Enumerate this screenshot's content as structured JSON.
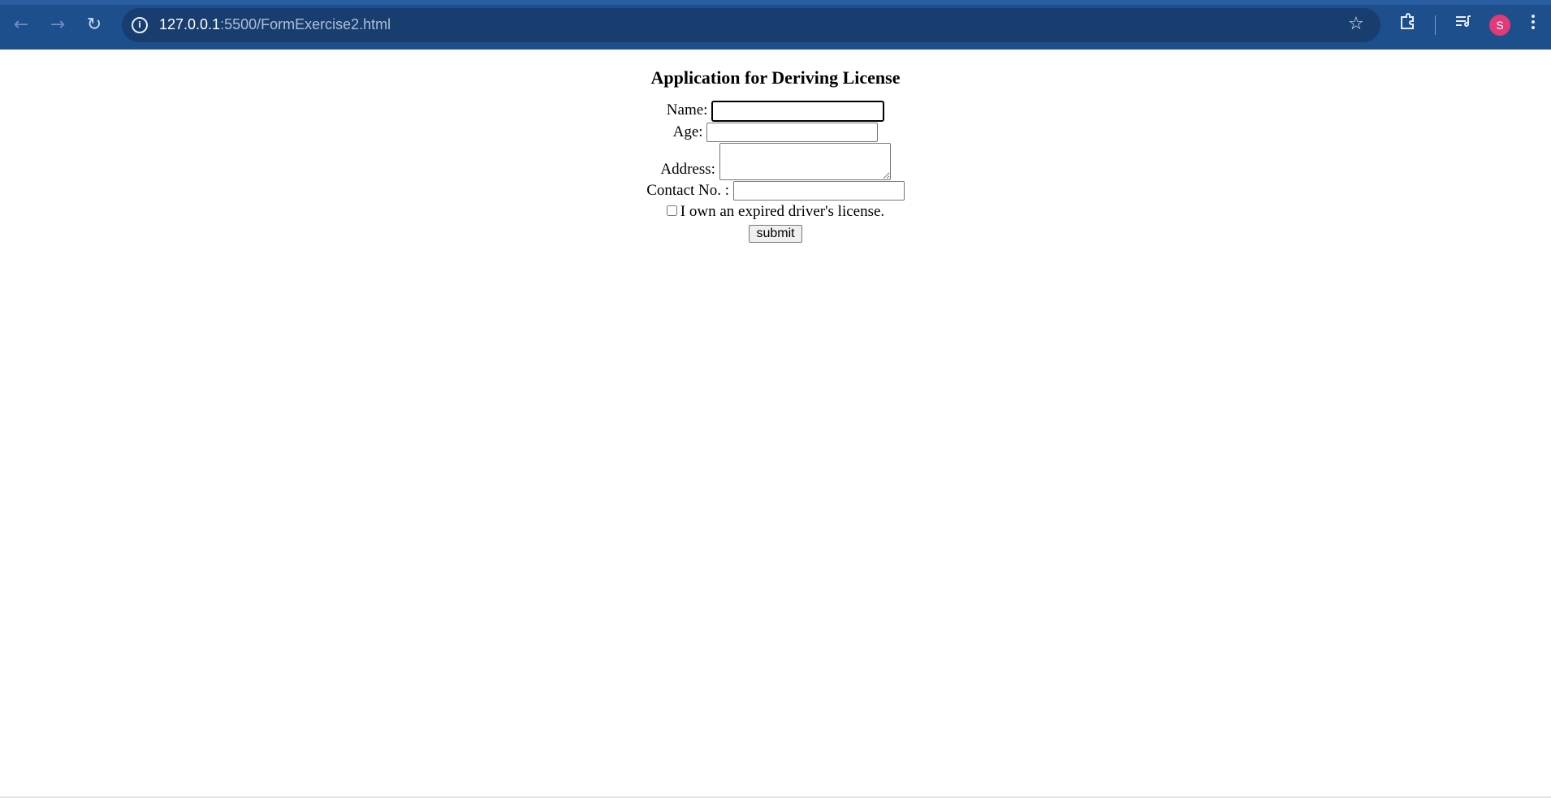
{
  "browser": {
    "back_icon": "←",
    "forward_icon": "→",
    "reload_icon": "↻",
    "url_host": "127.0.0.1",
    "url_rest": ":5500/FormExercise2.html",
    "info_icon": "i",
    "star_icon": "☆",
    "avatar_letter": "S"
  },
  "form": {
    "heading": "Application for Deriving License",
    "name_label": "Name: ",
    "age_label": "Age: ",
    "address_label": "Address: ",
    "contact_label": "Contact No. : ",
    "checkbox_label": "I own an expired driver's license.",
    "submit_label": "submit"
  }
}
